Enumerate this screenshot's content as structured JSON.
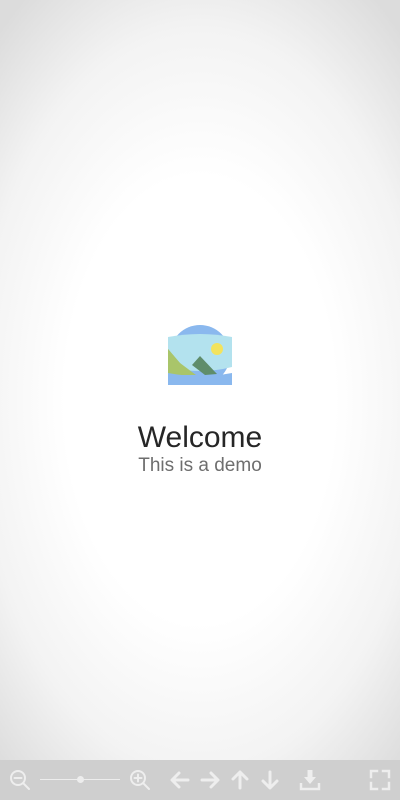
{
  "main": {
    "title": "Welcome",
    "subtitle": "This is a demo",
    "logo_icon": "landscape-image-icon"
  },
  "toolbar": {
    "zoom_level": 0.5,
    "icons": [
      "zoom-out-icon",
      "zoom-in-icon",
      "arrow-left-icon",
      "arrow-right-icon",
      "arrow-up-icon",
      "arrow-down-icon",
      "download-icon",
      "fullscreen-icon"
    ],
    "icon_color": "#eeeeee",
    "background": "#cfcfcf"
  },
  "colors": {
    "logo_sky": "#8ab8ee",
    "logo_band": "#b3e2ee",
    "logo_hill": "#a9c56a",
    "logo_mountain": "#5f8d6b",
    "logo_sun": "#f3e35d",
    "title_text": "#262626",
    "subtitle_text": "#6e6e6e"
  }
}
